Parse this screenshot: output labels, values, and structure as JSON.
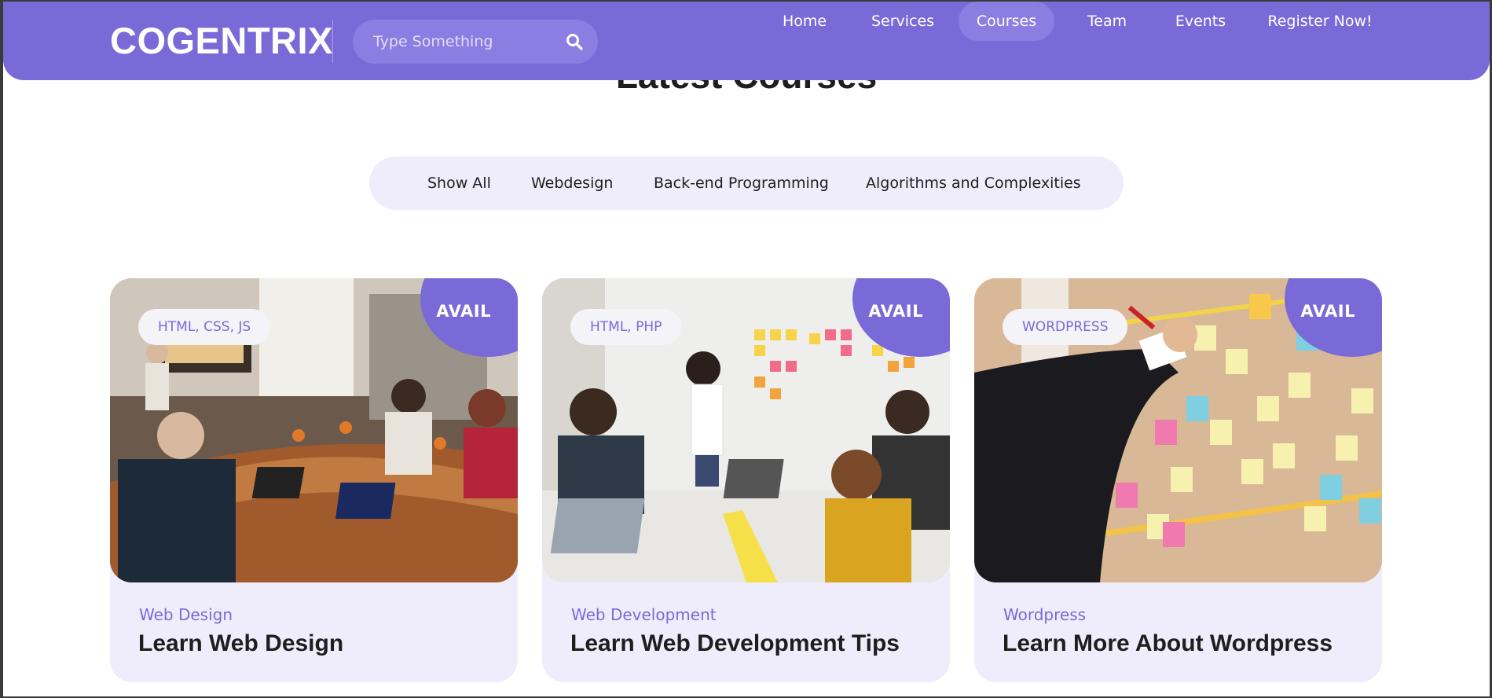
{
  "brand": {
    "logo": "COGENTRIX",
    "accent": "#7a6ad8",
    "light_bg": "#efedfc"
  },
  "search": {
    "placeholder": "Type Something",
    "icon": "search-icon"
  },
  "nav": {
    "items": [
      {
        "label": "Home",
        "active": false
      },
      {
        "label": "Services",
        "active": false
      },
      {
        "label": "Courses",
        "active": true
      },
      {
        "label": "Team",
        "active": false
      },
      {
        "label": "Events",
        "active": false
      },
      {
        "label": "Register Now!",
        "active": false
      }
    ]
  },
  "section": {
    "title": "Latest Courses"
  },
  "filters": [
    "Show All",
    "Webdesign",
    "Back-end Programming",
    "Algorithms and Complexities"
  ],
  "cards": [
    {
      "badge": "AVAIL",
      "tag": "HTML, CSS, JS",
      "category": "Web Design",
      "title": "Learn Web Design"
    },
    {
      "badge": "AVAIL",
      "tag": "HTML, PHP",
      "category": "Web Development",
      "title": "Learn Web Development Tips"
    },
    {
      "badge": "AVAIL",
      "tag": "WORDPRESS",
      "category": "Wordpress",
      "title": "Learn More About Wordpress"
    }
  ]
}
